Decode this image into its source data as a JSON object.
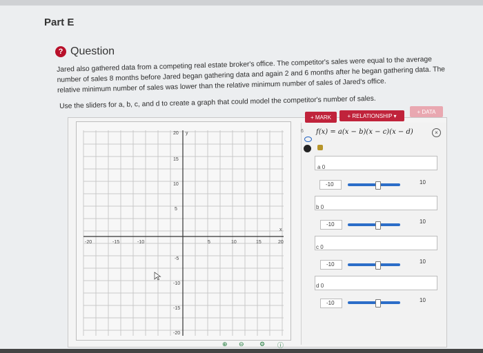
{
  "page": {
    "part_label": "Part E",
    "question_title": "Question",
    "question_icon": "?",
    "body_text": "Jared also gathered data from a competing real estate broker's office. The competitor's sales were equal to the average number of sales 8 months before Jared began gathering data and again 2 and 6 months after he began gathering data. The relative minimum number of sales was lower than the relative minimum number of sales of Jared's office.",
    "instruction": "Use the sliders for a, b, c, and d to create a graph that could model the competitor's number of sales."
  },
  "toolbar": {
    "mark": "+ MARK",
    "relationship": "+ RELATIONSHIP ▾",
    "data": "+ DATA"
  },
  "expression": {
    "index": "6",
    "formula": "f(x) = a(x − b)(x − c)(x − d)"
  },
  "params": [
    {
      "name": "a",
      "value": "0",
      "min": "-10",
      "max": "10"
    },
    {
      "name": "b",
      "value": "0",
      "min": "-10",
      "max": "10"
    },
    {
      "name": "c",
      "value": "0",
      "min": "-10",
      "max": "10"
    },
    {
      "name": "d",
      "value": "0",
      "min": "-10",
      "max": "10"
    }
  ],
  "graph": {
    "y_axis_label": "y",
    "x_axis_label": "x",
    "x_ticks": [
      "-20",
      "-15",
      "-10",
      "5",
      "10",
      "15",
      "20"
    ],
    "y_ticks": [
      "20",
      "15",
      "10",
      "5",
      "-5",
      "-10",
      "-15",
      "-20"
    ]
  },
  "colors": {
    "accent": "#c0233b",
    "slider": "#2b6dc8"
  },
  "bottom_icons": [
    "zoom-in-icon",
    "zoom-out-icon",
    "settings-icon",
    "help-icon"
  ]
}
